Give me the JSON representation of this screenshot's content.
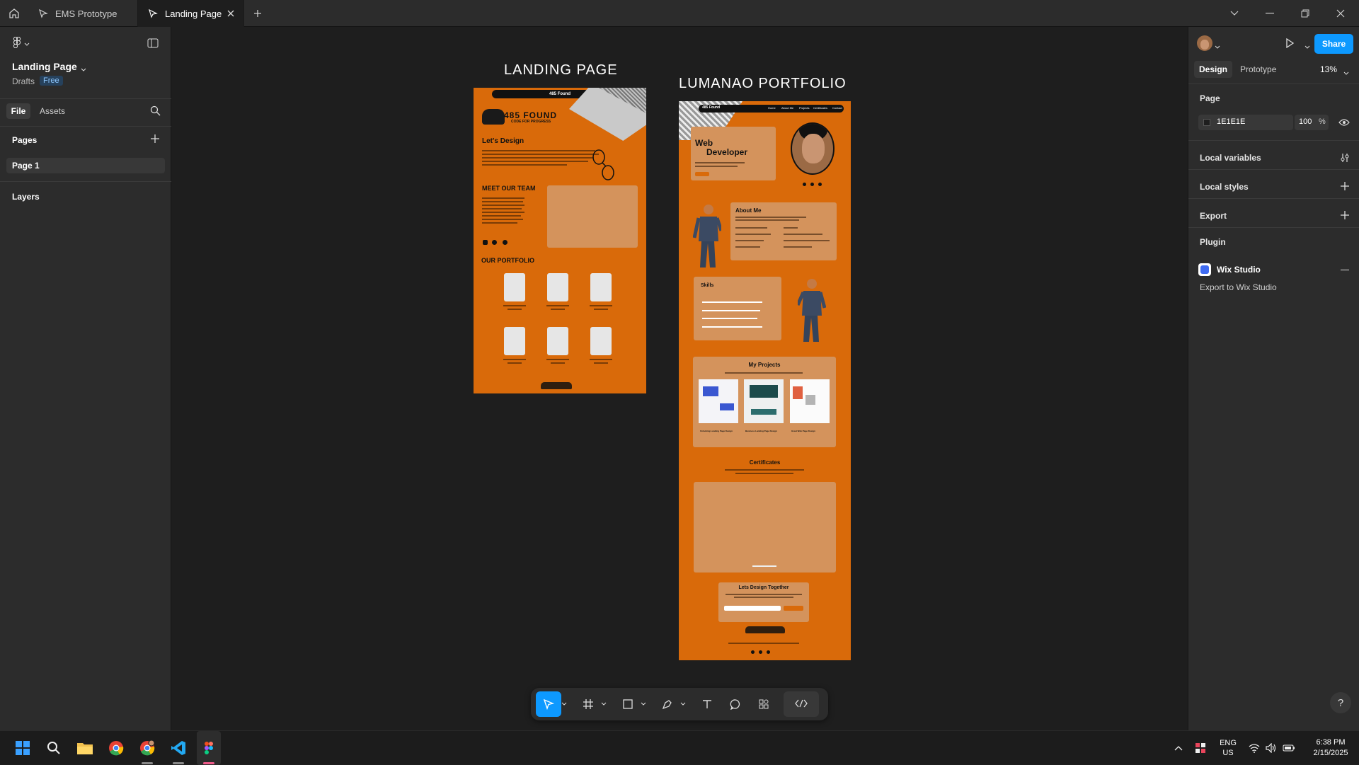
{
  "titlebar": {
    "tabs": [
      {
        "label": "EMS Prototype"
      },
      {
        "label": "Landing Page"
      }
    ]
  },
  "left": {
    "file_name": "Landing Page",
    "location": "Drafts",
    "plan": "Free",
    "tab_file": "File",
    "tab_assets": "Assets",
    "pages_header": "Pages",
    "page_item": "Page 1",
    "layers_header": "Layers"
  },
  "right": {
    "tab_design": "Design",
    "tab_prototype": "Prototype",
    "zoom": "13%",
    "share": "Share",
    "page_header": "Page",
    "page_color": "1E1E1E",
    "page_opacity": "100",
    "percent": "%",
    "local_variables": "Local variables",
    "local_styles": "Local styles",
    "export": "Export",
    "plugin_header": "Plugin",
    "plugin_name": "Wix Studio",
    "plugin_action": "Export to Wix Studio",
    "help": "?"
  },
  "frames": {
    "landing": {
      "title": "LANDING PAGE",
      "nav": "485 Found",
      "logo": "485 FOUND",
      "tagline": "CODE FOR PROGRESS",
      "heading": "Let's Design",
      "team": "MEET OUR TEAM",
      "portfolio": "OUR PORTFOLIO"
    },
    "portfolio": {
      "title": "LUMANAO PORTFOLIO",
      "nav_brand": "485 Found",
      "nav_links": [
        "Home",
        "About Me",
        "Projects",
        "Certificates",
        "Contact"
      ],
      "hero1": "Web",
      "hero2": "Developer",
      "about": "About Me",
      "skills": "Skills",
      "projects": "My Projects",
      "proj_names": [
        "Unlocking Landing Page Design",
        "Business Landing Page Design",
        "Great Web Page Design"
      ],
      "certs": "Certificates",
      "contact": "Lets Design Together",
      "logo": "485 FOUND"
    }
  },
  "taskbar": {
    "lang1": "ENG",
    "lang2": "US",
    "time": "6:38 PM",
    "date": "2/15/2025"
  },
  "colors": {
    "accent": "#0d99ff",
    "frame_orange": "#d96a0a",
    "card": "#d4935c"
  }
}
